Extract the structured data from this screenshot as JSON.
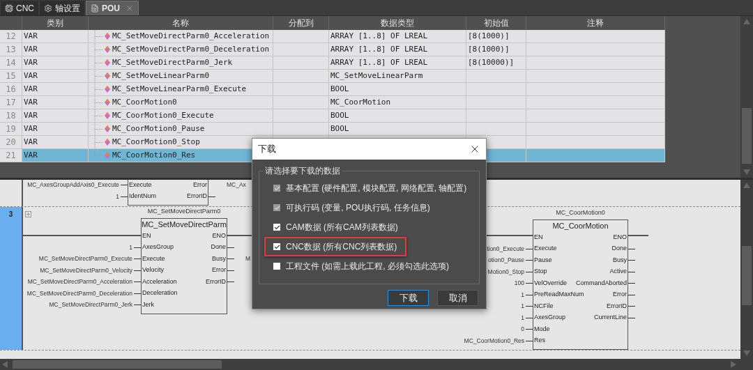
{
  "tabs": [
    {
      "label": "CNC",
      "selected": false
    },
    {
      "label": "轴设置",
      "selected": false
    },
    {
      "label": "POU",
      "selected": true,
      "closable": true
    }
  ],
  "table": {
    "columns": [
      "类别",
      "名称",
      "分配到",
      "数据类型",
      "初始值",
      "注释"
    ],
    "rows": [
      {
        "number": "12",
        "category": "VAR",
        "name": "MC_SetMoveDirectParm0_Acceleration",
        "data_type": "ARRAY [1..8] OF LREAL",
        "initial_value": "[8(1000)]",
        "selected": false
      },
      {
        "number": "13",
        "category": "VAR",
        "name": "MC_SetMoveDirectParm0_Deceleration",
        "data_type": "ARRAY [1..8] OF LREAL",
        "initial_value": "[8(1000)]",
        "selected": false
      },
      {
        "number": "14",
        "category": "VAR",
        "name": "MC_SetMoveDirectParm0_Jerk",
        "data_type": "ARRAY [1..8] OF LREAL",
        "initial_value": "[8(10000)]",
        "selected": false
      },
      {
        "number": "15",
        "category": "VAR",
        "name": "MC_SetMoveLinearParm0",
        "data_type": "MC_SetMoveLinearParm",
        "selected": false
      },
      {
        "number": "16",
        "category": "VAR",
        "name": "MC_SetMoveLinearParm0_Execute",
        "data_type": "BOOL",
        "selected": false
      },
      {
        "number": "17",
        "category": "VAR",
        "name": "MC_CoorMotion0",
        "data_type": "MC_CoorMotion",
        "selected": false
      },
      {
        "number": "18",
        "category": "VAR",
        "name": "MC_CoorMotion0_Execute",
        "data_type": "BOOL",
        "selected": false
      },
      {
        "number": "19",
        "category": "VAR",
        "name": "MC_CoorMotion0_Pause",
        "data_type": "BOOL",
        "selected": false
      },
      {
        "number": "20",
        "category": "VAR",
        "name": "MC_CoorMotion0_Stop",
        "selected": false
      },
      {
        "number": "21",
        "category": "VAR",
        "name": "MC_CoorMotion0_Res",
        "selected": true
      }
    ]
  },
  "ladder": {
    "rungs": [
      {
        "selected": false,
        "blocks": [
          {
            "inputs": [
              {
                "pin": "Execute",
                "variable": "MC_AxesGroupAddAxis0_Execute"
              },
              {
                "pin": "IdentNum",
                "variable": "1"
              }
            ],
            "outputs": [
              {
                "pin": "Error",
                "variable": "MC_Ax"
              },
              {
                "pin": "ErrorID"
              }
            ]
          }
        ]
      },
      {
        "number": "3",
        "selected": true,
        "blocks": [
          {
            "instance": "MC_SetMoveDirectParm0",
            "type": "MC_SetMoveDirectParm",
            "inputs": [
              {
                "pin": "EN"
              },
              {
                "pin": "AxesGroup",
                "variable": "1"
              },
              {
                "pin": "Execute",
                "variable": "MC_SetMoveDirectParm0_Execute"
              },
              {
                "pin": "Velocity",
                "variable": "MC_SetMoveDirectParm0_Velocity"
              },
              {
                "pin": "Acceleration",
                "variable": "MC_SetMoveDirectParm0_Acceleration"
              },
              {
                "pin": "Deceleration",
                "variable": "MC_SetMoveDirectParm0_Deceleration"
              },
              {
                "pin": "Jerk",
                "variable": "MC_SetMoveDirectParm0_Jerk"
              }
            ],
            "outputs": [
              {
                "pin": "ENO"
              },
              {
                "pin": "Done"
              },
              {
                "pin": "Busy",
                "variable": "M"
              },
              {
                "pin": "Error"
              },
              {
                "pin": "ErrorID"
              }
            ]
          },
          {
            "instance": "MC_CoorMotion0",
            "type": "MC_CoorMotion",
            "inputs": [
              {
                "pin": "EN"
              },
              {
                "pin": "Execute",
                "variable": "tion0_Execute"
              },
              {
                "pin": "Pause",
                "variable": "otion0_Pause"
              },
              {
                "pin": "Stop",
                "variable": "Motion0_Stop"
              },
              {
                "pin": "VelOverride",
                "variable": "100"
              },
              {
                "pin": "PreReadMaxNum",
                "variable": "1"
              },
              {
                "pin": "NCFile",
                "variable": "1"
              },
              {
                "pin": "AxesGroup",
                "variable": "1"
              },
              {
                "pin": "Mode",
                "variable": "0"
              },
              {
                "pin": "Res",
                "variable": "MC_CoorMotion0_Res"
              }
            ],
            "outputs": [
              {
                "pin": "ENO"
              },
              {
                "pin": "Done"
              },
              {
                "pin": "Busy"
              },
              {
                "pin": "Active"
              },
              {
                "pin": "CommandAborted"
              },
              {
                "pin": "Error"
              },
              {
                "pin": "ErrorID"
              },
              {
                "pin": "CurrentLine"
              }
            ]
          }
        ]
      }
    ]
  },
  "dialog": {
    "title": "下载",
    "group_label": "请选择要下载的数据",
    "options": [
      {
        "label": "基本配置 (硬件配置, 模块配置, 网络配置, 轴配置)",
        "checked": true,
        "disabled": true,
        "highlighted": false
      },
      {
        "label": "可执行码 (变量, POU执行码, 任务信息)",
        "checked": true,
        "disabled": true,
        "highlighted": false
      },
      {
        "label": "CAM数据 (所有CAM列表数据)",
        "checked": true,
        "disabled": false,
        "highlighted": false
      },
      {
        "label": "CNC数据 (所有CNC列表数据)",
        "checked": true,
        "disabled": false,
        "highlighted": true
      },
      {
        "label": "工程文件 (如需上载此工程, 必须勾选此选项)",
        "checked": false,
        "disabled": false,
        "highlighted": false
      }
    ],
    "buttons": [
      {
        "label": "下载",
        "default": true
      },
      {
        "label": "取消",
        "default": false
      }
    ]
  }
}
